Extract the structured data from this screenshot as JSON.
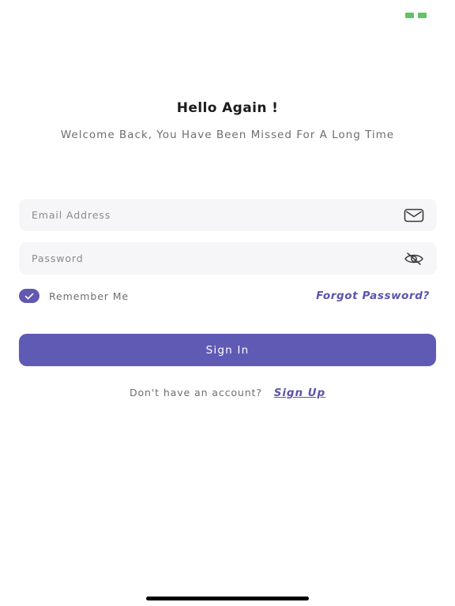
{
  "header": {
    "title": "Hello Again !",
    "subtitle": "Welcome Back, You Have Been Missed For A Long Time"
  },
  "form": {
    "email": {
      "placeholder": "Email Address",
      "value": "",
      "icon": "envelope-icon"
    },
    "password": {
      "placeholder": "Password",
      "value": "",
      "icon": "eye-off-icon"
    },
    "remember": {
      "label": "Remember Me",
      "checked": true
    },
    "forgot_label": "Forgot Password?",
    "submit_label": "Sign In"
  },
  "footer": {
    "prompt": "Don't have an account?",
    "signup_label": "Sign Up"
  },
  "colors": {
    "accent": "#5f5ab4",
    "link": "#5b53ac",
    "field_bg": "#f6f6f8",
    "status_green": "#5ec464"
  }
}
